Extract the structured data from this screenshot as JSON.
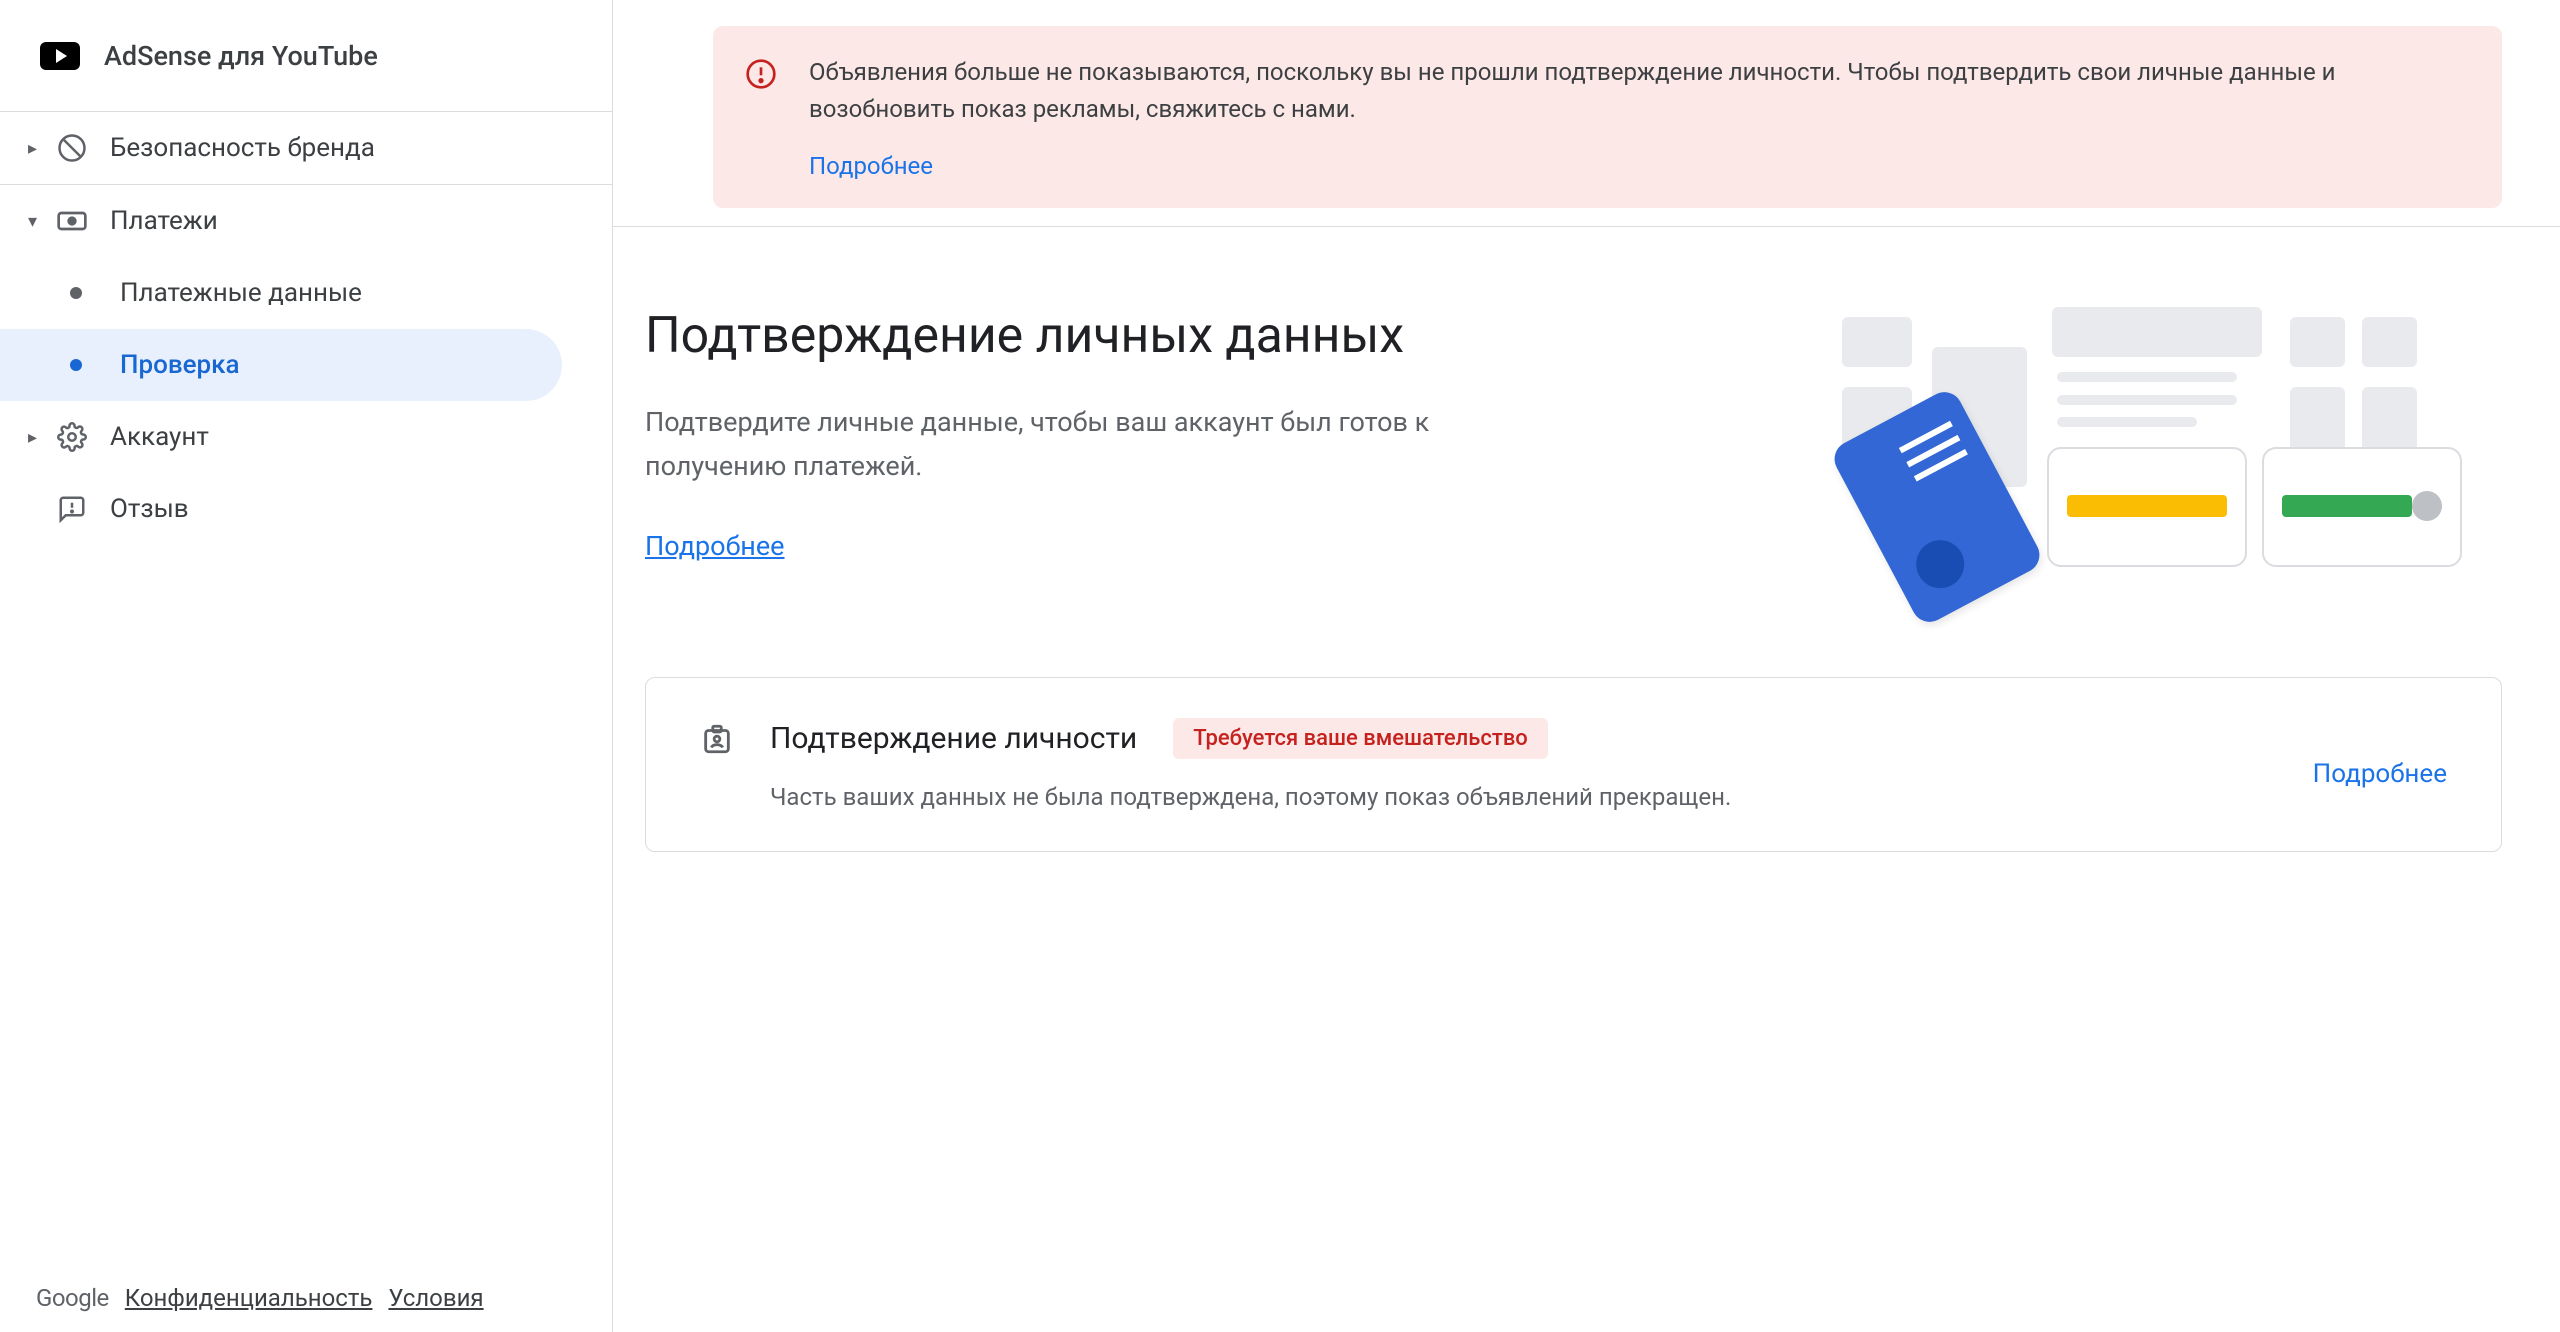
{
  "sidebar": {
    "header_title": "AdSense для YouTube",
    "items": [
      {
        "label": "Безопасность бренда",
        "icon": "block-icon"
      },
      {
        "label": "Платежи",
        "icon": "payments-icon"
      },
      {
        "label": "Аккаунт",
        "icon": "settings-icon"
      },
      {
        "label": "Отзыв",
        "icon": "feedback-icon"
      }
    ],
    "sub_items": [
      {
        "label": "Платежные данные"
      },
      {
        "label": "Проверка"
      }
    ],
    "footer": {
      "logo": "Google",
      "privacy": "Конфиденциальность",
      "terms": "Условия"
    }
  },
  "alert": {
    "text": "Объявления больше не показываются, поскольку вы не прошли подтверждение личности. Чтобы подтвердить свои личные данные и возобновить показ рекламы, свяжитесь с нами.",
    "link": "Подробнее"
  },
  "main": {
    "title": "Подтверждение личных данных",
    "subtitle": "Подтвердите личные данные, чтобы ваш аккаунт был готов к получению платежей.",
    "learn_more": "Подробнее"
  },
  "card": {
    "title": "Подтверждение личности",
    "status": "Требуется ваше вмешательство",
    "desc": "Часть ваших данных не была подтверждена, поэтому показ объявлений прекращен.",
    "action": "Подробнее"
  }
}
